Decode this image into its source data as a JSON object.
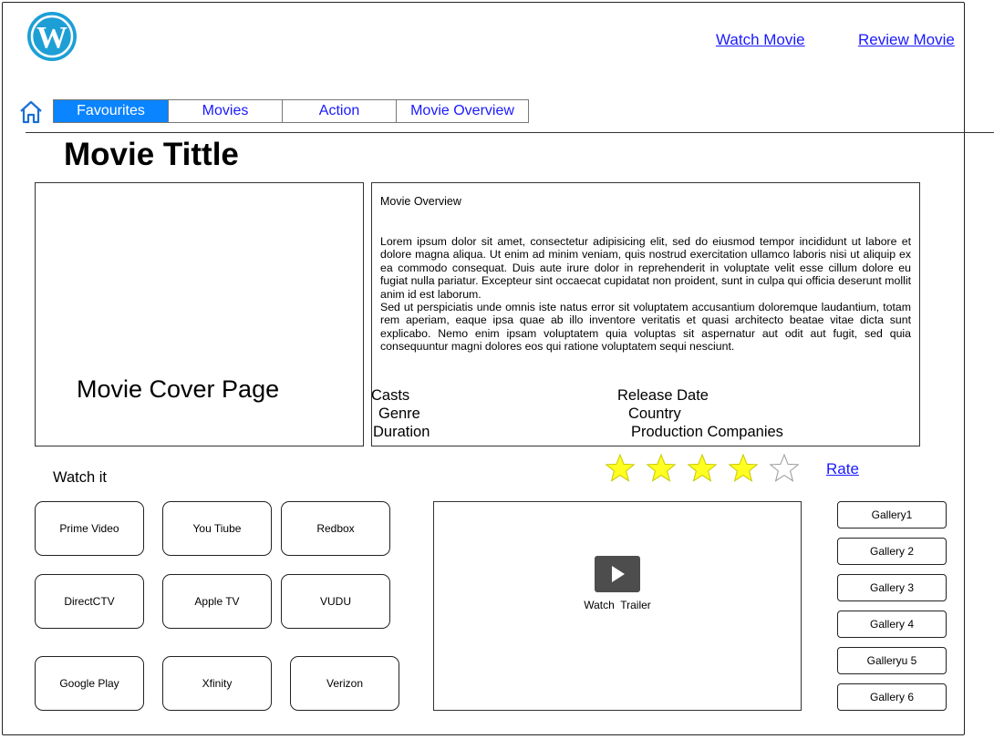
{
  "header": {
    "logo_icon": "wordpress-logo",
    "links": [
      "Watch Movie",
      "Review Movie"
    ]
  },
  "nav": {
    "home_icon": "home-icon",
    "tabs": [
      "Favourites",
      "Movies",
      "Action",
      "Movie Overview"
    ],
    "active_tab": "Favourites"
  },
  "movie": {
    "title": "Movie Tittle",
    "cover_label": "Movie Cover Page",
    "overview_heading": "Movie Overview",
    "overview_p1": "Lorem ipsum dolor sit amet, consectetur adipisicing elit, sed do eiusmod tempor incididunt ut labore et dolore magna aliqua. Ut enim ad minim veniam, quis nostrud exercitation ullamco laboris nisi ut aliquip ex ea commodo consequat. Duis aute irure dolor in reprehenderit in voluptate velit esse cillum dolore eu fugiat nulla pariatur. Excepteur sint occaecat cupidatat non proident, sunt in culpa qui officia deserunt mollit anim id est laborum.",
    "overview_p2": "Sed ut perspiciatis unde omnis iste natus error sit voluptatem accusantium doloremque laudantium, totam rem aperiam, eaque ipsa quae ab illo inventore veritatis et quasi architecto beatae vitae dicta sunt explicabo. Nemo enim ipsam voluptatem quia voluptas sit aspernatur aut odit aut fugit, sed quia consequuntur magni dolores eos qui ratione voluptatem sequi nesciunt.",
    "details": {
      "casts": "Casts",
      "genre": "Genre",
      "duration": "Duration",
      "release_date": "Release Date",
      "country": "Country",
      "production": "Production Companies"
    }
  },
  "rating": {
    "stars_filled": 4,
    "stars_total": 5,
    "filled_color": "#ffff22",
    "rate_label": "Rate"
  },
  "watch": {
    "label": "Watch it",
    "services": [
      "Prime Video",
      "You Tiube",
      "Redbox",
      "DirectCTV",
      "Apple TV",
      "VUDU",
      "Google Play",
      "Xfinity",
      "Verizon"
    ]
  },
  "trailer": {
    "label": "Watch  Trailer",
    "play_icon": "play-icon"
  },
  "gallery": [
    "Gallery1",
    "Gallery 2",
    "Gallery 3",
    "Gallery 4",
    "Galleryu 5",
    "Gallery 6"
  ]
}
